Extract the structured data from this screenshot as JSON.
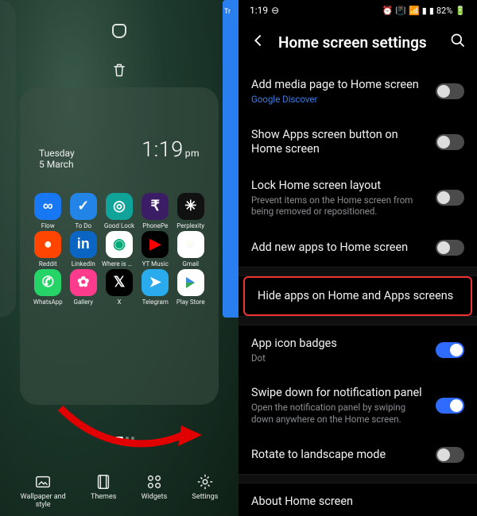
{
  "left": {
    "date_day": "Tuesday",
    "date_date": "5 March",
    "time": "1:19",
    "ampm": "pm",
    "apps": [
      {
        "label": "Flow",
        "glyph": "∞",
        "bg": "bg-blue",
        "fg": "#fff"
      },
      {
        "label": "To Do",
        "glyph": "✓",
        "bg": "bg-check",
        "fg": "#fff"
      },
      {
        "label": "Good Lock",
        "glyph": "◎",
        "bg": "bg-teal",
        "fg": "#fff"
      },
      {
        "label": "PhonePe",
        "glyph": "₹",
        "bg": "bg-purple",
        "fg": "#fff"
      },
      {
        "label": "Perplexity",
        "glyph": "✳",
        "bg": "bg-perp",
        "fg": "#fff"
      },
      {
        "label": "Reddit",
        "glyph": "●",
        "bg": "bg-reddit",
        "fg": "#fff"
      },
      {
        "label": "LinkedIn",
        "glyph": "in",
        "bg": "bg-linkedin",
        "fg": "#fff"
      },
      {
        "label": "Where is my..",
        "glyph": "◉",
        "bg": "bg-white",
        "fg": "#0a7"
      },
      {
        "label": "YT Music",
        "glyph": "▶",
        "bg": "bg-yt",
        "fg": "#f00"
      },
      {
        "label": "Gmail",
        "glyph": "M",
        "bg": "bg-gmail",
        "fg": ""
      },
      {
        "label": "WhatsApp",
        "glyph": "✆",
        "bg": "bg-wa",
        "fg": "#fff"
      },
      {
        "label": "Gallery",
        "glyph": "✿",
        "bg": "bg-gallery",
        "fg": "#fff"
      },
      {
        "label": "X",
        "glyph": "𝕏",
        "bg": "bg-x",
        "fg": "#fff"
      },
      {
        "label": "Telegram",
        "glyph": "➤",
        "bg": "bg-tg",
        "fg": "#fff"
      },
      {
        "label": "Play Store",
        "glyph": "▶",
        "bg": "bg-play",
        "fg": "#34a853"
      }
    ],
    "bottombar": [
      {
        "label": "Wallpaper and\nstyle"
      },
      {
        "label": "Themes"
      },
      {
        "label": "Widgets"
      },
      {
        "label": "Settings"
      }
    ],
    "side_app_hint": "Tr"
  },
  "right": {
    "status": {
      "time": "1:19",
      "battery": "82%"
    },
    "title": "Home screen settings",
    "rows": [
      {
        "title": "Add media page to Home screen",
        "sub": "Google Discover",
        "subclass": "link",
        "toggle": false
      },
      {
        "title": "Show Apps screen button on Home screen",
        "toggle": false
      },
      {
        "title": "Lock Home screen layout",
        "sub": "Prevent items on the Home screen from being removed or repositioned.",
        "toggle": false
      },
      {
        "title": "Add new apps to Home screen",
        "toggle": false
      },
      {
        "title": "Hide apps on Home and Apps screens",
        "highlight": true
      },
      {
        "title": "App icon badges",
        "sub": "Dot",
        "toggle": true
      },
      {
        "title": "Swipe down for notification panel",
        "sub": "Open the notification panel by swiping down anywhere on the Home screen.",
        "toggle": true
      },
      {
        "title": "Rotate to landscape mode",
        "toggle": false
      },
      {
        "title": "About Home screen"
      }
    ]
  }
}
